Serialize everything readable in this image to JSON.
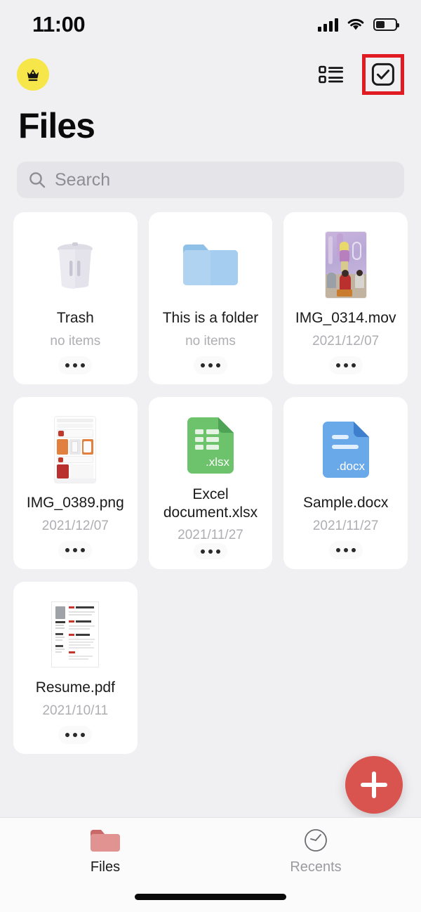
{
  "status_bar": {
    "time": "11:00",
    "signal_icon": "cellular-signal-icon",
    "wifi_icon": "wifi-icon",
    "battery_icon": "battery-icon",
    "battery_level_percent": 45
  },
  "header": {
    "premium_badge_icon": "crown-icon",
    "premium_badge_color": "#f7e64a",
    "list_view_icon": "list-view-icon",
    "select_mode_icon": "checkbox-select-icon",
    "highlight_color": "#e01b22"
  },
  "page": {
    "title": "Files"
  },
  "search": {
    "placeholder": "Search",
    "value": "",
    "icon": "search-icon"
  },
  "files": [
    {
      "name": "Trash",
      "subtitle": "no items",
      "icon": "trash-can-icon",
      "kind": "trash",
      "more_icon": "more-options-icon"
    },
    {
      "name": "This is a folder",
      "subtitle": "no items",
      "icon": "folder-icon",
      "kind": "folder",
      "more_icon": "more-options-icon"
    },
    {
      "name": "IMG_0314.mov",
      "subtitle": "2021/12/07",
      "icon": "video-thumbnail",
      "kind": "video",
      "more_icon": "more-options-icon"
    },
    {
      "name": "IMG_0389.png",
      "subtitle": "2021/12/07",
      "icon": "image-thumbnail",
      "kind": "image",
      "more_icon": "more-options-icon"
    },
    {
      "name": "Excel document.xlsx",
      "subtitle": "2021/11/27",
      "icon": "xlsx-file-icon",
      "kind": "xlsx",
      "extension_label": ".xlsx",
      "color": "#6cc36c",
      "more_icon": "more-options-icon"
    },
    {
      "name": "Sample.docx",
      "subtitle": "2021/11/27",
      "icon": "docx-file-icon",
      "kind": "docx",
      "extension_label": ".docx",
      "color": "#6aa9e9",
      "more_icon": "more-options-icon"
    },
    {
      "name": "Resume.pdf",
      "subtitle": "2021/10/11",
      "icon": "pdf-thumbnail",
      "kind": "pdf",
      "more_icon": "more-options-icon"
    }
  ],
  "fab": {
    "label": "+",
    "icon": "plus-icon",
    "color": "#d9534f"
  },
  "tab_bar": {
    "tabs": [
      {
        "label": "Files",
        "icon": "folder-icon",
        "active": true
      },
      {
        "label": "Recents",
        "icon": "clock-icon",
        "active": false
      }
    ]
  }
}
